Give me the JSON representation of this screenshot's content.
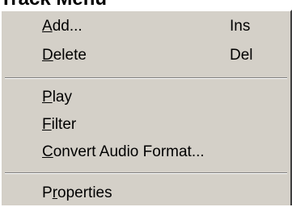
{
  "title": "Track Menu",
  "menu": {
    "items": [
      {
        "mnemonic": "A",
        "rest": "dd...",
        "shortcut": "Ins"
      },
      {
        "mnemonic": "D",
        "rest": "elete",
        "shortcut": "Del"
      },
      {
        "mnemonic": "P",
        "rest": "lay",
        "shortcut": ""
      },
      {
        "mnemonic": "F",
        "rest": "ilter",
        "shortcut": ""
      },
      {
        "mnemonic": "C",
        "rest": "onvert Audio Format...",
        "shortcut": ""
      },
      {
        "prefix": "P",
        "mnemonic": "r",
        "rest": "operties",
        "shortcut": ""
      }
    ]
  }
}
